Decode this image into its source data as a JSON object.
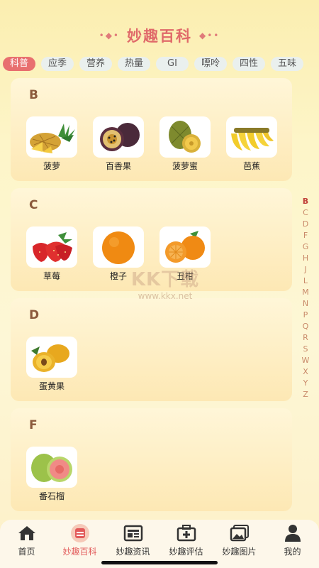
{
  "header": {
    "title": "妙趣百科",
    "deco_left": "•◆•",
    "deco_right": "◆••"
  },
  "tabs": [
    "科普",
    "应季",
    "营养",
    "热量",
    "GI",
    "嘌呤",
    "四性",
    "五味"
  ],
  "sections": [
    {
      "letter": "B",
      "items": [
        {
          "name": "菠萝",
          "icon": "pineapple-image"
        },
        {
          "name": "百香果",
          "icon": "passion-fruit-image"
        },
        {
          "name": "菠萝蜜",
          "icon": "jackfruit-image"
        },
        {
          "name": "芭蕉",
          "icon": "banana-image"
        }
      ]
    },
    {
      "letter": "C",
      "items": [
        {
          "name": "草莓",
          "icon": "strawberry-image"
        },
        {
          "name": "橙子",
          "icon": "orange-image"
        },
        {
          "name": "丑柑",
          "icon": "ugly-tangerine-image"
        }
      ]
    },
    {
      "letter": "D",
      "items": [
        {
          "name": "蛋黄果",
          "icon": "egg-fruit-image"
        }
      ]
    },
    {
      "letter": "F",
      "items": [
        {
          "name": "番石榴",
          "icon": "guava-image"
        }
      ]
    }
  ],
  "index_letters": [
    "B",
    "C",
    "D",
    "F",
    "G",
    "H",
    "J",
    "L",
    "M",
    "N",
    "P",
    "Q",
    "R",
    "S",
    "W",
    "X",
    "Y",
    "Z"
  ],
  "watermark": {
    "logo": "KK下载",
    "url": "www.kkx.net"
  },
  "bottom_nav": [
    {
      "label": "首页",
      "icon": "home-icon"
    },
    {
      "label": "妙趣百科",
      "icon": "encyclopedia-icon"
    },
    {
      "label": "妙趣资讯",
      "icon": "news-icon"
    },
    {
      "label": "妙趣评估",
      "icon": "assessment-icon"
    },
    {
      "label": "妙趣图片",
      "icon": "picture-icon"
    },
    {
      "label": "我的",
      "icon": "profile-icon"
    }
  ],
  "colors": {
    "accent": "#e86f6f",
    "title": "#e06a6a",
    "letter": "#8b5a3c",
    "index": "#c98a6a"
  }
}
